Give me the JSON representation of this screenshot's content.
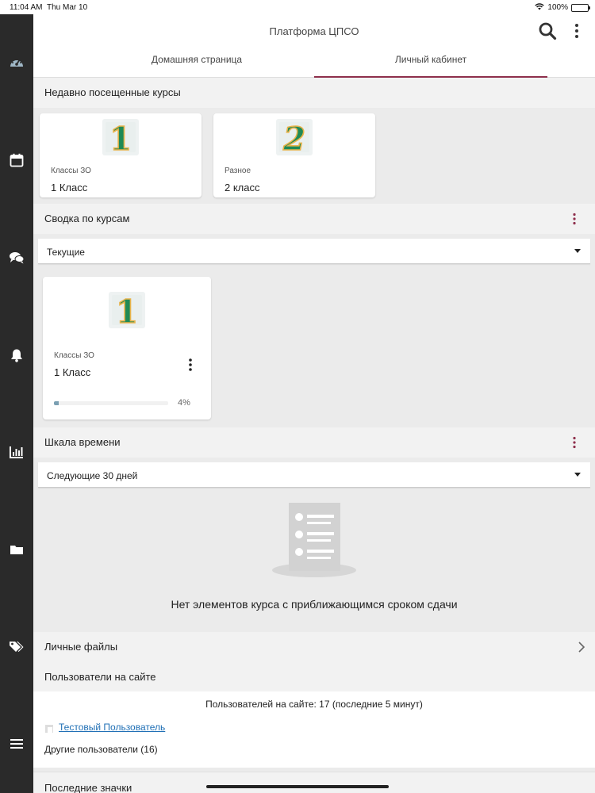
{
  "status_bar": {
    "time": "11:04 AM",
    "date": "Thu Mar 10",
    "battery": "100%"
  },
  "sidebar": {
    "items": [
      {
        "icon": "dashboard-icon"
      },
      {
        "icon": "calendar-icon"
      },
      {
        "icon": "chat-icon"
      },
      {
        "icon": "bell-icon"
      },
      {
        "icon": "chart-icon"
      },
      {
        "icon": "folder-icon"
      },
      {
        "icon": "tag-icon"
      },
      {
        "icon": "menu-icon"
      }
    ]
  },
  "header": {
    "title": "Платформа ЦПСО",
    "tabs": [
      {
        "label": "Домашняя страница"
      },
      {
        "label": "Личный кабинет"
      }
    ]
  },
  "recent": {
    "title": "Недавно посещенные курсы",
    "courses": [
      {
        "number": "1",
        "category": "Классы ЗО",
        "name": "1 Класс"
      },
      {
        "number": "2",
        "category": "Разное",
        "name": "2 класс"
      }
    ]
  },
  "overview": {
    "title": "Сводка по курсам",
    "filter": "Текущие",
    "course": {
      "number": "1",
      "category": "Классы ЗО",
      "name": "1 Класс",
      "progress_text": "4%",
      "progress": 4
    }
  },
  "timeline": {
    "title": "Шкала времени",
    "filter": "Следующие 30 дней",
    "empty_text": "Нет элементов курса с приближающимся сроком сдачи"
  },
  "private_files": {
    "label": "Личные файлы"
  },
  "online_users": {
    "title": "Пользователи на сайте",
    "count_text": "Пользователей на сайте: 17 (последние 5 минут)",
    "user": "Тестовый Пользователь",
    "others": "Другие пользователи (16)"
  },
  "badges": {
    "title": "Последние значки"
  },
  "colors": {
    "accent": "#8e2f4c",
    "sidebar_bg": "#2a2a2a",
    "badge_green": "#1f8a56",
    "badge_gold": "#e8b34a",
    "link": "#1f6fb5"
  }
}
